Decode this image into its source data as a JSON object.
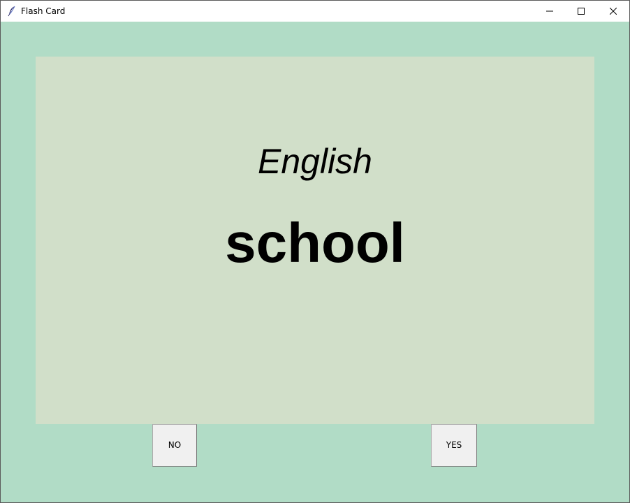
{
  "window": {
    "title": "Flash Card",
    "icon": "feather-icon",
    "controls": [
      "minimize-icon",
      "maximize-icon",
      "close-icon"
    ]
  },
  "card": {
    "language": "English",
    "word": "school"
  },
  "buttons": {
    "no_label": "NO",
    "yes_label": "YES"
  },
  "colors": {
    "background": "#b1dcc6",
    "card": "#d1dfc9",
    "button_face": "#f0f0f0"
  }
}
